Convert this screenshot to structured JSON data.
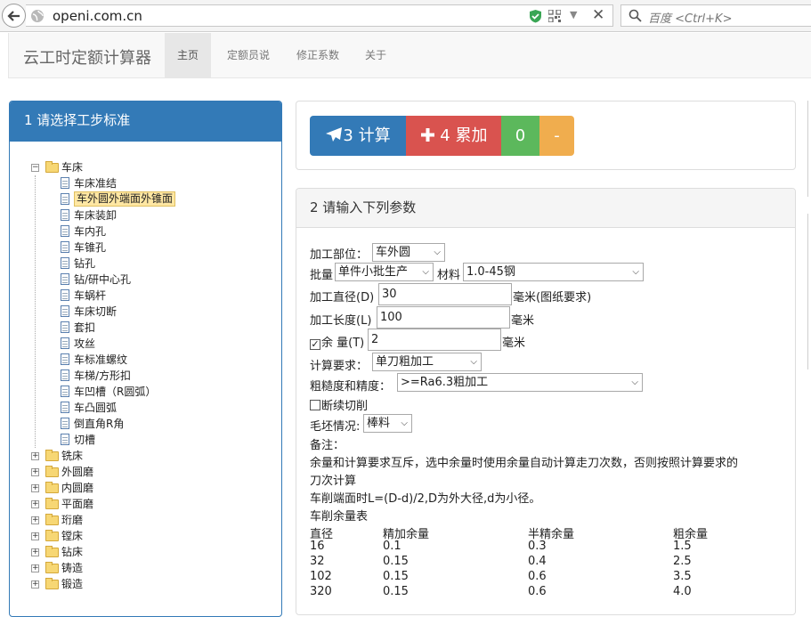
{
  "browser": {
    "url": "openi.com.cn",
    "search_placeholder": "百度 <Ctrl+K>"
  },
  "navbar": {
    "brand": "云工时定额计算器",
    "items": [
      {
        "label": "主页",
        "active": true
      },
      {
        "label": "定额员说",
        "active": false
      },
      {
        "label": "修正系数",
        "active": false
      },
      {
        "label": "关于",
        "active": false
      }
    ]
  },
  "left_panel": {
    "title": "1 请选择工步标准",
    "tree": [
      {
        "label": "车床",
        "type": "folder",
        "expanded": true,
        "children": [
          {
            "label": "车床准结"
          },
          {
            "label": "车外圆外端面外锥面",
            "selected": true
          },
          {
            "label": "车床装卸"
          },
          {
            "label": "车内孔"
          },
          {
            "label": "车锥孔"
          },
          {
            "label": "钻孔"
          },
          {
            "label": "钻/研中心孔"
          },
          {
            "label": "车蜗杆"
          },
          {
            "label": "车床切断"
          },
          {
            "label": "套扣"
          },
          {
            "label": "攻丝"
          },
          {
            "label": "车标准螺纹"
          },
          {
            "label": "车梯/方形扣"
          },
          {
            "label": "车凹槽（R圆弧）"
          },
          {
            "label": "车凸圆弧"
          },
          {
            "label": "倒直角R角"
          },
          {
            "label": "切槽"
          }
        ]
      },
      {
        "label": "铣床",
        "type": "folder",
        "expanded": false
      },
      {
        "label": "外圆磨",
        "type": "folder",
        "expanded": false
      },
      {
        "label": "内圆磨",
        "type": "folder",
        "expanded": false
      },
      {
        "label": "平面磨",
        "type": "folder",
        "expanded": false
      },
      {
        "label": "珩磨",
        "type": "folder",
        "expanded": false
      },
      {
        "label": "镗床",
        "type": "folder",
        "expanded": false
      },
      {
        "label": "钻床",
        "type": "folder",
        "expanded": false
      },
      {
        "label": "铸造",
        "type": "folder",
        "expanded": false
      },
      {
        "label": "锻造",
        "type": "folder",
        "expanded": false
      }
    ]
  },
  "buttons": {
    "calc_label": "3 计算",
    "add_label": "4 累加",
    "zero_label": "0",
    "minus_label": "-"
  },
  "params": {
    "title": "2 请输入下列参数",
    "part_label": "加工部位：",
    "part_value": "车外圆",
    "batch_label": "批量",
    "batch_value": "单件小批生产",
    "material_label": "材料",
    "material_value": "1.0-45钢",
    "diameter_label": "加工直径(D)",
    "diameter_value": "30",
    "diameter_unit": "毫米(图纸要求)",
    "length_label": "加工长度(L)",
    "length_value": "100",
    "length_unit": "毫米",
    "allowance_checked": true,
    "allowance_label": "余 量(T)",
    "allowance_value": "2",
    "allowance_unit": "毫米",
    "requirement_label": "计算要求：",
    "requirement_value": "单刀粗加工",
    "roughness_label": "粗糙度和精度：",
    "roughness_value": ">=Ra6.3粗加工",
    "interrupted_checked": false,
    "interrupted_label": "断续切削",
    "blank_label": "毛坯情况:",
    "blank_value": "棒料",
    "notes_label": "备注：",
    "note1": "余量和计算要求互斥，选中余量时使用余量自动计算走刀次数，否则按照计算要求的",
    "note1b": "刀次计算",
    "note2": "车削端面时L=(D-d)/2,D为外大径,d为小径。",
    "table_title": "车削余量表",
    "table_headers": [
      "直径",
      "精加余量",
      "半精余量",
      "粗余量"
    ],
    "table_rows": [
      [
        "16",
        "0.1",
        "0.3",
        "1.5"
      ],
      [
        "32",
        "0.15",
        "0.4",
        "2.5"
      ],
      [
        "102",
        "0.15",
        "0.6",
        "3.5"
      ],
      [
        "320",
        "0.15",
        "0.6",
        "4.0"
      ]
    ]
  }
}
